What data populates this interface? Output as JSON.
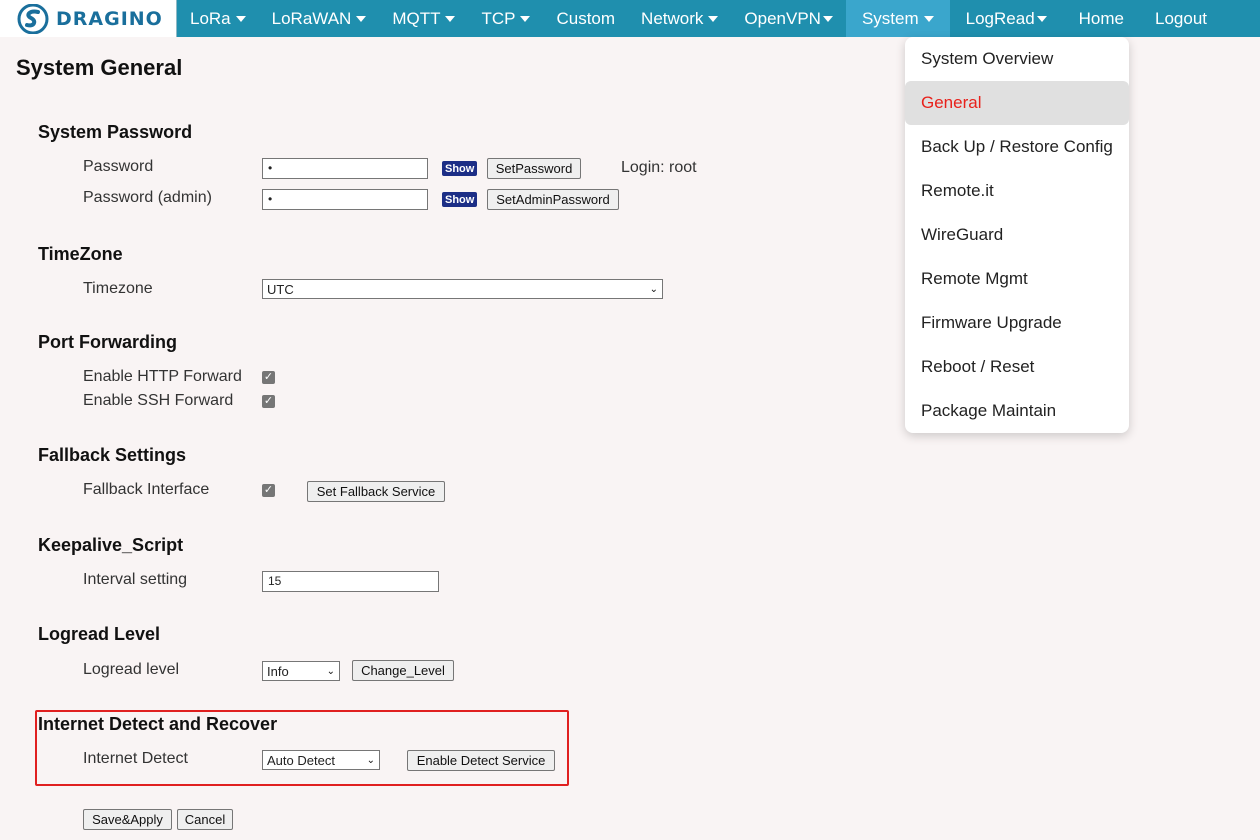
{
  "nav": {
    "logo_text": "DRAGINO",
    "items": [
      {
        "label": "LoRa",
        "caret": true
      },
      {
        "label": "LoRaWAN",
        "caret": true
      },
      {
        "label": "MQTT",
        "caret": true
      },
      {
        "label": "TCP",
        "caret": true
      },
      {
        "label": "Custom",
        "caret": false
      },
      {
        "label": "Network",
        "caret": true
      },
      {
        "label": "OpenVPN",
        "caret": true
      },
      {
        "label": "System",
        "caret": true,
        "active": true
      },
      {
        "label": "LogRead",
        "caret": true
      },
      {
        "label": "Home",
        "caret": false
      },
      {
        "label": "Logout",
        "caret": false
      }
    ]
  },
  "page_title": "System General",
  "sections": {
    "password": {
      "title": "System Password",
      "password_label": "Password",
      "password_value": "•",
      "show_label": "Show",
      "set_password": "SetPassword",
      "login_text": "Login: root",
      "admin_label": "Password (admin)",
      "admin_value": "•",
      "set_admin_password": "SetAdminPassword"
    },
    "timezone": {
      "title": "TimeZone",
      "label": "Timezone",
      "value": "UTC"
    },
    "port_forwarding": {
      "title": "Port Forwarding",
      "http_label": "Enable HTTP Forward",
      "http_checked": true,
      "ssh_label": "Enable SSH Forward",
      "ssh_checked": true
    },
    "fallback": {
      "title": "Fallback Settings",
      "label": "Fallback Interface",
      "checked": true,
      "button": "Set Fallback Service"
    },
    "keepalive": {
      "title": "Keepalive_Script",
      "label": "Interval setting",
      "value": "15"
    },
    "logread": {
      "title": "Logread Level",
      "label": "Logread level",
      "value": "Info",
      "button": "Change_Level"
    },
    "internet_detect": {
      "title": "Internet Detect and Recover",
      "label": "Internet Detect",
      "value": "Auto Detect",
      "button": "Enable Detect Service"
    }
  },
  "actions": {
    "save": "Save&Apply",
    "cancel": "Cancel"
  },
  "system_menu": {
    "items": [
      "System Overview",
      "General",
      "Back Up / Restore Config",
      "Remote.it",
      "WireGuard",
      "Remote Mgmt",
      "Firmware Upgrade",
      "Reboot / Reset",
      "Package Maintain"
    ],
    "selected_index": 1
  },
  "colors": {
    "nav_bg": "#1f8fae",
    "nav_active": "#3aa6cc",
    "selected_text": "#e8211b",
    "highlight": "#e02020"
  }
}
